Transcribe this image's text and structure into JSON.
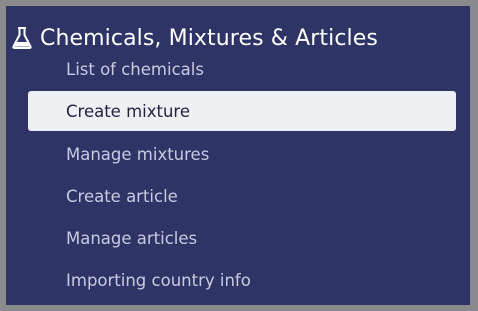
{
  "panel": {
    "title": "Chemicals, Mixtures & Articles",
    "icon": "flask-icon",
    "colors": {
      "background": "#2e3466",
      "frame": "#8a8a8c",
      "text": "#ffffff",
      "item_text": "#c8cbe0",
      "active_bg": "#eef0f4",
      "active_text": "#1f2340"
    }
  },
  "menu": {
    "items": [
      {
        "label": "List of chemicals",
        "selected": false
      },
      {
        "label": "Create mixture",
        "selected": true
      },
      {
        "label": "Manage mixtures",
        "selected": false
      },
      {
        "label": "Create article",
        "selected": false
      },
      {
        "label": "Manage articles",
        "selected": false
      },
      {
        "label": "Importing country info",
        "selected": false
      }
    ]
  }
}
